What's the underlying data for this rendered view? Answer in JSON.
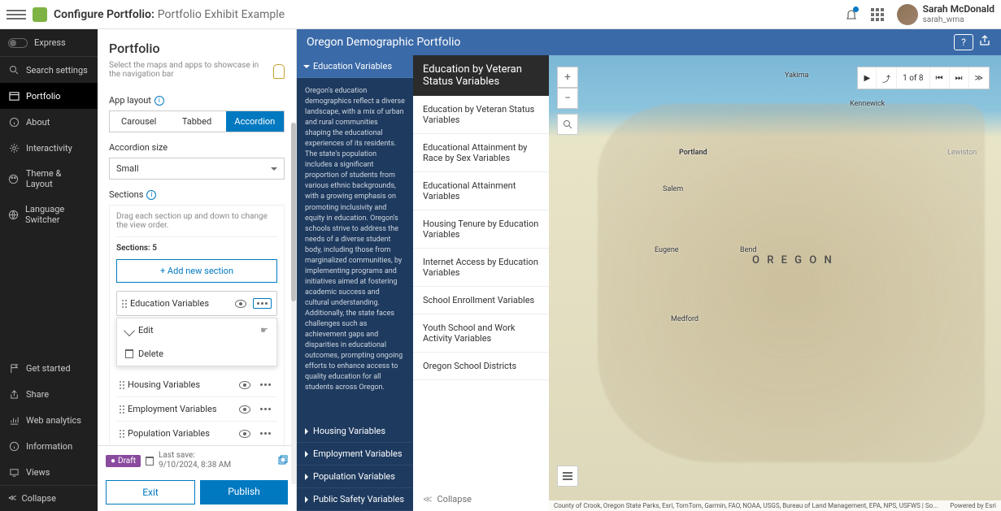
{
  "topbar": {
    "title": "Configure Portfolio:",
    "subtitle": "Portfolio Exhibit Example",
    "user_name": "Sarah McDonald",
    "user_handle": "sarah_wma"
  },
  "sidenav": {
    "express": "Express",
    "search_ph": "Search settings",
    "items": [
      {
        "label": "Portfolio",
        "active": true,
        "icon": "layout"
      },
      {
        "label": "About",
        "icon": "info"
      },
      {
        "label": "Interactivity",
        "icon": "gear"
      },
      {
        "label": "Theme & Layout",
        "icon": "palette"
      },
      {
        "label": "Language Switcher",
        "icon": "globe"
      }
    ],
    "bottom": [
      {
        "label": "Get started",
        "icon": "flag"
      },
      {
        "label": "Share",
        "icon": "share"
      },
      {
        "label": "Web analytics",
        "icon": "chart"
      },
      {
        "label": "Information",
        "icon": "info"
      },
      {
        "label": "Views",
        "icon": "device"
      }
    ],
    "collapse": "Collapse"
  },
  "config": {
    "header": "Portfolio",
    "hint": "Select the maps and apps to showcase in the navigation bar",
    "applayout": "App layout",
    "layouts": {
      "carousel": "Carousel",
      "tabbed": "Tabbed",
      "accordion": "Accordion"
    },
    "accsize_label": "Accordion size",
    "accsize_value": "Small",
    "sections_label": "Sections",
    "drag_hint": "Drag each section up and down to change the view order.",
    "sections_count": "Sections: 5",
    "add_new": "+    Add new section",
    "list": [
      "Education Variables",
      "Housing Variables",
      "Employment Variables",
      "Population Variables"
    ],
    "ctx_edit": "Edit",
    "ctx_delete": "Delete",
    "draft": "Draft",
    "lastsave_label": "Last save:",
    "lastsave_time": "9/10/2024, 8:38 AM",
    "exit": "Exit",
    "publish": "Publish"
  },
  "preview": {
    "banner": "Oregon Demographic Portfolio",
    "nav": [
      {
        "label": "Education Variables",
        "active": true
      },
      {
        "label": "Housing Variables"
      },
      {
        "label": "Employment Variables"
      },
      {
        "label": "Population Variables"
      },
      {
        "label": "Public Safety Variables"
      }
    ],
    "desc": "Oregon's education demographics reflect a diverse landscape, with a mix of urban and rural communities shaping the educational experiences of its residents. The state's population includes a significant proportion of students from various ethnic backgrounds, with a growing emphasis on promoting inclusivity and equity in education. Oregon's schools strive to address the needs of a diverse student body, including those from marginalized communities, by implementing programs and initiatives aimed at fostering academic success and cultural understanding. Additionally, the state faces challenges such as achievement gaps and disparities in educational outcomes, prompting ongoing efforts to enhance access to quality education for all students across Oregon.",
    "subtitle": "Education by Veteran Status Variables",
    "subitems": [
      "Education by Veteran Status Variables",
      "Educational Attainment by Race by Sex Variables",
      "Educational Attainment Variables",
      "Housing Tenure by Education Variables",
      "Internet Access by Education Variables",
      "School Enrollment Variables",
      "Youth School and Work Activity Variables",
      "Oregon School Districts"
    ],
    "collapse": "Collapse",
    "page": "1 of 8",
    "attrib_left": "County of Crook, Oregon State Parks, Esri, TomTom, Garmin, FAO, NOAA, USGS, Bureau of Land Management, EPA, NPS, USFWS | So...",
    "attrib_right": "Powered by Esri",
    "cities": {
      "yakima": "Yakima",
      "kennewick": "Kennewick",
      "lewiston": "Lewiston",
      "portland": "Portland",
      "salem": "Salem",
      "eugene": "Eugene",
      "bend": "Bend",
      "medford": "Medford",
      "oregon": "O R E G O N"
    }
  }
}
